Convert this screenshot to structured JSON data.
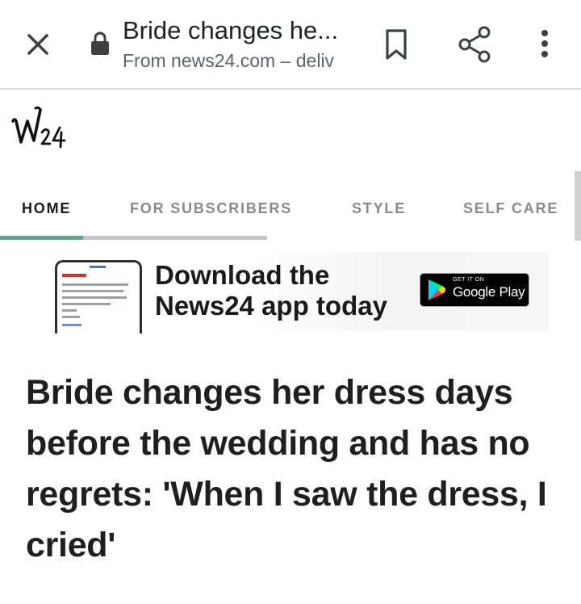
{
  "toolbar": {
    "title": "Bride changes he...",
    "url_domain": "From news24.com",
    "url_separator": " – ",
    "url_path": "deliv",
    "icons": [
      "close-icon",
      "lock-icon",
      "bookmark-icon",
      "share-icon",
      "more-vert-icon"
    ]
  },
  "site": {
    "logo_text": "W24"
  },
  "nav": {
    "tabs": [
      {
        "label": "HOME",
        "active": true
      },
      {
        "label": "FOR SUBSCRIBERS",
        "active": false
      },
      {
        "label": "STYLE",
        "active": false
      },
      {
        "label": "SELF CARE",
        "active": false
      }
    ],
    "indicator_color": "#6a9f92"
  },
  "promo": {
    "line1": "Download the",
    "line2": "News24 app today",
    "store_badge_small": "GET IT ON",
    "store_badge_big": "Google Play"
  },
  "article": {
    "headline": "Bride changes her dress days before the wedding and has no regrets: 'When I saw the dress, I cried'"
  },
  "colors": {
    "text": "#202124",
    "secondary_text": "#5f6368",
    "toolbar_divider": "#dcdcdc",
    "nav_inactive": "#8a8a8a"
  }
}
